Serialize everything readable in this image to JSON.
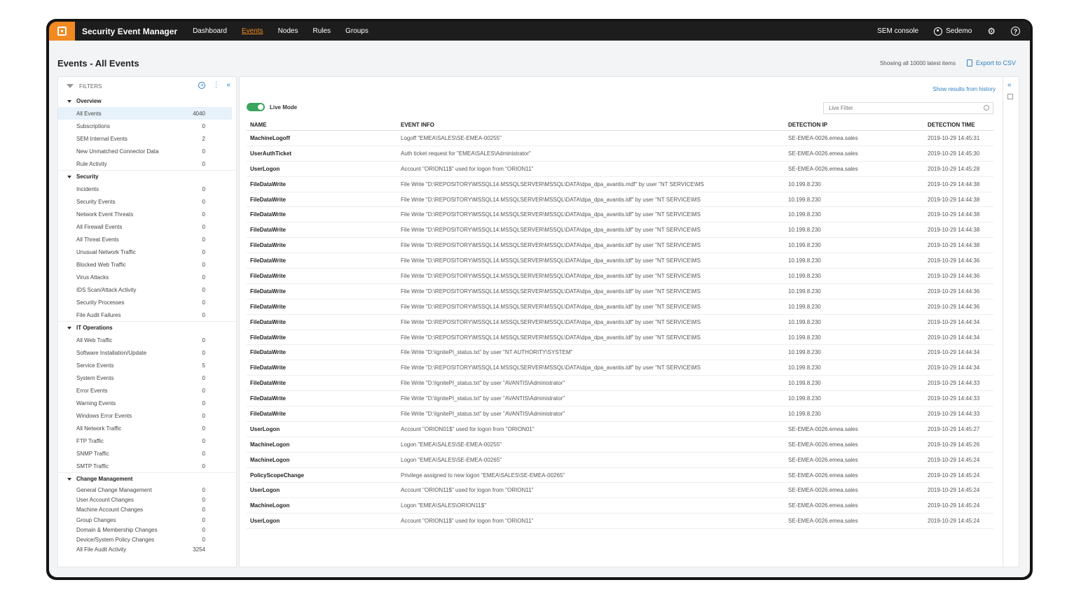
{
  "app": {
    "title": "Security Event Manager",
    "nav": [
      "Dashboard",
      "Events",
      "Nodes",
      "Rules",
      "Groups"
    ],
    "active_nav": "Events",
    "console_label": "SEM console",
    "user_name": "Sedemo",
    "accent_color": "#f28a22"
  },
  "page": {
    "title": "Events - All Events",
    "showing_text": "Showing all 10000 latest items",
    "export_label": "Export to CSV"
  },
  "filters": {
    "header": "FILTERS",
    "groups": [
      {
        "name": "Overview",
        "items": [
          {
            "label": "All Events",
            "count": "4040",
            "selected": true
          },
          {
            "label": "Subscriptions",
            "count": "0"
          },
          {
            "label": "SEM Internal Events",
            "count": "2"
          },
          {
            "label": "New Unmatched Connector Data",
            "count": "0"
          },
          {
            "label": "Rule Activity",
            "count": "0"
          }
        ]
      },
      {
        "name": "Security",
        "items": [
          {
            "label": "Incidents",
            "count": "0"
          },
          {
            "label": "Security Events",
            "count": "0"
          },
          {
            "label": "Network Event Threats",
            "count": "0"
          },
          {
            "label": "All Firewall Events",
            "count": "0"
          },
          {
            "label": "All Threat Events",
            "count": "0"
          },
          {
            "label": "Unusual Network Traffic",
            "count": "0"
          },
          {
            "label": "Blocked Web Traffic",
            "count": "0"
          },
          {
            "label": "Virus Attacks",
            "count": "0"
          },
          {
            "label": "IDS Scan/Attack Activity",
            "count": "0"
          },
          {
            "label": "Security Processes",
            "count": "0"
          },
          {
            "label": "File Audit Failures",
            "count": "0"
          }
        ]
      },
      {
        "name": "IT Operations",
        "items": [
          {
            "label": "All Web Traffic",
            "count": "0"
          },
          {
            "label": "Software Installation/Update",
            "count": "0"
          },
          {
            "label": "Service Events",
            "count": "5"
          },
          {
            "label": "System Events",
            "count": "0"
          },
          {
            "label": "Error Events",
            "count": "0"
          },
          {
            "label": "Warning Events",
            "count": "0"
          },
          {
            "label": "Windows Error Events",
            "count": "0"
          },
          {
            "label": "All Network Traffic",
            "count": "0"
          },
          {
            "label": "FTP Traffic",
            "count": "0"
          },
          {
            "label": "SNMP Traffic",
            "count": "0"
          },
          {
            "label": "SMTP Traffic",
            "count": "0"
          }
        ]
      },
      {
        "name": "Change Management",
        "items": [
          {
            "label": "General Change Management",
            "count": "0"
          },
          {
            "label": "User Account Changes",
            "count": "0"
          },
          {
            "label": "Machine Account Changes",
            "count": "0"
          },
          {
            "label": "Group Changes",
            "count": "0"
          },
          {
            "label": "Domain & Membership Changes",
            "count": "0"
          },
          {
            "label": "Device/System Policy Changes",
            "count": "0"
          },
          {
            "label": "All File Audit Activity",
            "count": "3254"
          }
        ]
      }
    ]
  },
  "main": {
    "history_link": "Show results from history",
    "live_mode_label": "Live Mode",
    "live_mode_on": true,
    "live_filter_placeholder": "Live Filter",
    "columns": [
      "NAME",
      "EVENT INFO",
      "DETECTION IP",
      "DETECTION TIME"
    ],
    "rows": [
      [
        "MachineLogoff",
        "Logoff \"EMEA\\SALES\\SE-EMEA-00255\"",
        "SE-EMEA-0026.emea.sales",
        "2019-10-29 14:45:31"
      ],
      [
        "UserAuthTicket",
        "Auth ticket request for \"EMEA\\SALES\\Administrator\"",
        "SE-EMEA-0026.emea.sales",
        "2019-10-29 14:45:30"
      ],
      [
        "UserLogon",
        "Account \"ORION11$\" used for logon from \"ORION11\"",
        "SE-EMEA-0026.emea.sales",
        "2019-10-29 14:45:28"
      ],
      [
        "FileDataWrite",
        "File Write \"D:\\REPOSITORY\\MSSQL14.MSSQLSERVER\\MSSQL\\DATA\\dpa_dpa_avantis.mdf\" by user \"NT SERVICE\\MS",
        "10.199.8.230",
        "2019-10-29 14:44:38"
      ],
      [
        "FileDataWrite",
        "File Write \"D:\\REPOSITORY\\MSSQL14.MSSQLSERVER\\MSSQL\\DATA\\dpa_dpa_avantis.ldf\" by user \"NT SERVICE\\MS",
        "10.199.8.230",
        "2019-10-29 14:44:38"
      ],
      [
        "FileDataWrite",
        "File Write \"D:\\REPOSITORY\\MSSQL14.MSSQLSERVER\\MSSQL\\DATA\\dpa_dpa_avantis.ldf\" by user \"NT SERVICE\\MS",
        "10.199.8.230",
        "2019-10-29 14:44:38"
      ],
      [
        "FileDataWrite",
        "File Write \"D:\\REPOSITORY\\MSSQL14.MSSQLSERVER\\MSSQL\\DATA\\dpa_dpa_avantis.ldf\" by user \"NT SERVICE\\MS",
        "10.199.8.230",
        "2019-10-29 14:44:38"
      ],
      [
        "FileDataWrite",
        "File Write \"D:\\REPOSITORY\\MSSQL14.MSSQLSERVER\\MSSQL\\DATA\\dpa_dpa_avantis.ldf\" by user \"NT SERVICE\\MS",
        "10.199.8.230",
        "2019-10-29 14:44:38"
      ],
      [
        "FileDataWrite",
        "File Write \"D:\\REPOSITORY\\MSSQL14.MSSQLSERVER\\MSSQL\\DATA\\dpa_dpa_avantis.ldf\" by user \"NT SERVICE\\MS",
        "10.199.8.230",
        "2019-10-29 14:44:36"
      ],
      [
        "FileDataWrite",
        "File Write \"D:\\REPOSITORY\\MSSQL14.MSSQLSERVER\\MSSQL\\DATA\\dpa_dpa_avantis.ldf\" by user \"NT SERVICE\\MS",
        "10.199.8.230",
        "2019-10-29 14:44:36"
      ],
      [
        "FileDataWrite",
        "File Write \"D:\\REPOSITORY\\MSSQL14.MSSQLSERVER\\MSSQL\\DATA\\dpa_dpa_avantis.ldf\" by user \"NT SERVICE\\MS",
        "10.199.8.230",
        "2019-10-29 14:44:36"
      ],
      [
        "FileDataWrite",
        "File Write \"D:\\REPOSITORY\\MSSQL14.MSSQLSERVER\\MSSQL\\DATA\\dpa_dpa_avantis.ldf\" by user \"NT SERVICE\\MS",
        "10.199.8.230",
        "2019-10-29 14:44:36"
      ],
      [
        "FileDataWrite",
        "File Write \"D:\\REPOSITORY\\MSSQL14.MSSQLSERVER\\MSSQL\\DATA\\dpa_dpa_avantis.ldf\" by user \"NT SERVICE\\MS",
        "10.199.8.230",
        "2019-10-29 14:44:34"
      ],
      [
        "FileDataWrite",
        "File Write \"D:\\REPOSITORY\\MSSQL14.MSSQLSERVER\\MSSQL\\DATA\\dpa_dpa_avantis.ldf\" by user \"NT SERVICE\\MS",
        "10.199.8.230",
        "2019-10-29 14:44:34"
      ],
      [
        "FileDataWrite",
        "File Write \"D:\\IgnitePI_status.txt\" by user \"NT AUTHORITY\\SYSTEM\"",
        "10.199.8.230",
        "2019-10-29 14:44:34"
      ],
      [
        "FileDataWrite",
        "File Write \"D:\\REPOSITORY\\MSSQL14.MSSQLSERVER\\MSSQL\\DATA\\dpa_dpa_avantis.ldf\" by user \"NT SERVICE\\MS",
        "10.199.8.230",
        "2019-10-29 14:44:34"
      ],
      [
        "FileDataWrite",
        "File Write \"D:\\IgnitePI_status.txt\" by user \"AVANTIS\\Administrator\"",
        "10.199.8.230",
        "2019-10-29 14:44:33"
      ],
      [
        "FileDataWrite",
        "File Write \"D:\\IgnitePI_status.txt\" by user \"AVANTIS\\Administrator\"",
        "10.199.8.230",
        "2019-10-29 14:44:33"
      ],
      [
        "FileDataWrite",
        "File Write \"D:\\IgnitePI_status.txt\" by user \"AVANTIS\\Administrator\"",
        "10.199.8.230",
        "2019-10-29 14:44:33"
      ],
      [
        "UserLogon",
        "Account \"ORION01$\" used for logon from \"ORION01\"",
        "SE-EMEA-0026.emea.sales",
        "2019-10-29 14:45:27"
      ],
      [
        "MachineLogon",
        "Logon \"EMEA\\SALES\\SE-EMEA-00255\"",
        "SE-EMEA-0026.emea.sales",
        "2019-10-29 14:45:26"
      ],
      [
        "MachineLogon",
        "Logon \"EMEA\\SALES\\SE-EMEA-00265\"",
        "SE-EMEA-0026.emea.sales",
        "2019-10-29 14:45:24"
      ],
      [
        "PolicyScopeChange",
        "Privilege assigned to new logon \"EMEA\\SALES\\SE-EMEA-00265\"",
        "SE-EMEA-0026.emea.sales",
        "2019-10-29 14:45:24"
      ],
      [
        "UserLogon",
        "Account \"ORION11$\" used for logon from \"ORION11\"",
        "SE-EMEA-0026.emea.sales",
        "2019-10-29 14:45:24"
      ],
      [
        "MachineLogon",
        "Logon \"EMEA\\SALES\\ORION11$\"",
        "SE-EMEA-0026.emea.sales",
        "2019-10-29 14:45:24"
      ],
      [
        "UserLogon",
        "Account \"ORION11$\" used for logon from \"ORION11\"",
        "SE-EMEA-0026.emea.sales",
        "2019-10-29 14:45:24"
      ]
    ]
  }
}
